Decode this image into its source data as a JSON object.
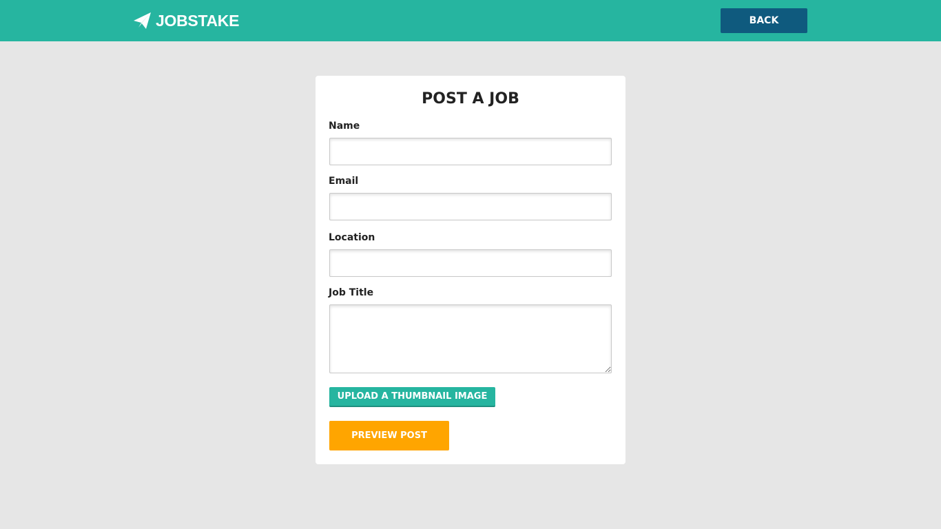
{
  "header": {
    "brand": "JOBSTAKE",
    "logo_icon": "paper-plane-icon",
    "back_label": "BACK",
    "bg_color": "#26b5a0"
  },
  "form": {
    "title": "POST A JOB",
    "fields": [
      {
        "label": "Name",
        "value": ""
      },
      {
        "label": "Email",
        "value": ""
      },
      {
        "label": "Location",
        "value": ""
      },
      {
        "label": "Job Title",
        "value": ""
      }
    ],
    "upload_label": "UPLOAD A THUMBNAIL IMAGE",
    "preview_label": "PREVIEW POST"
  },
  "colors": {
    "accent": "#26b5a0",
    "back_button": "#0f5a7e",
    "preview_button": "#ffa500",
    "page_bg": "#e6e6e6"
  }
}
